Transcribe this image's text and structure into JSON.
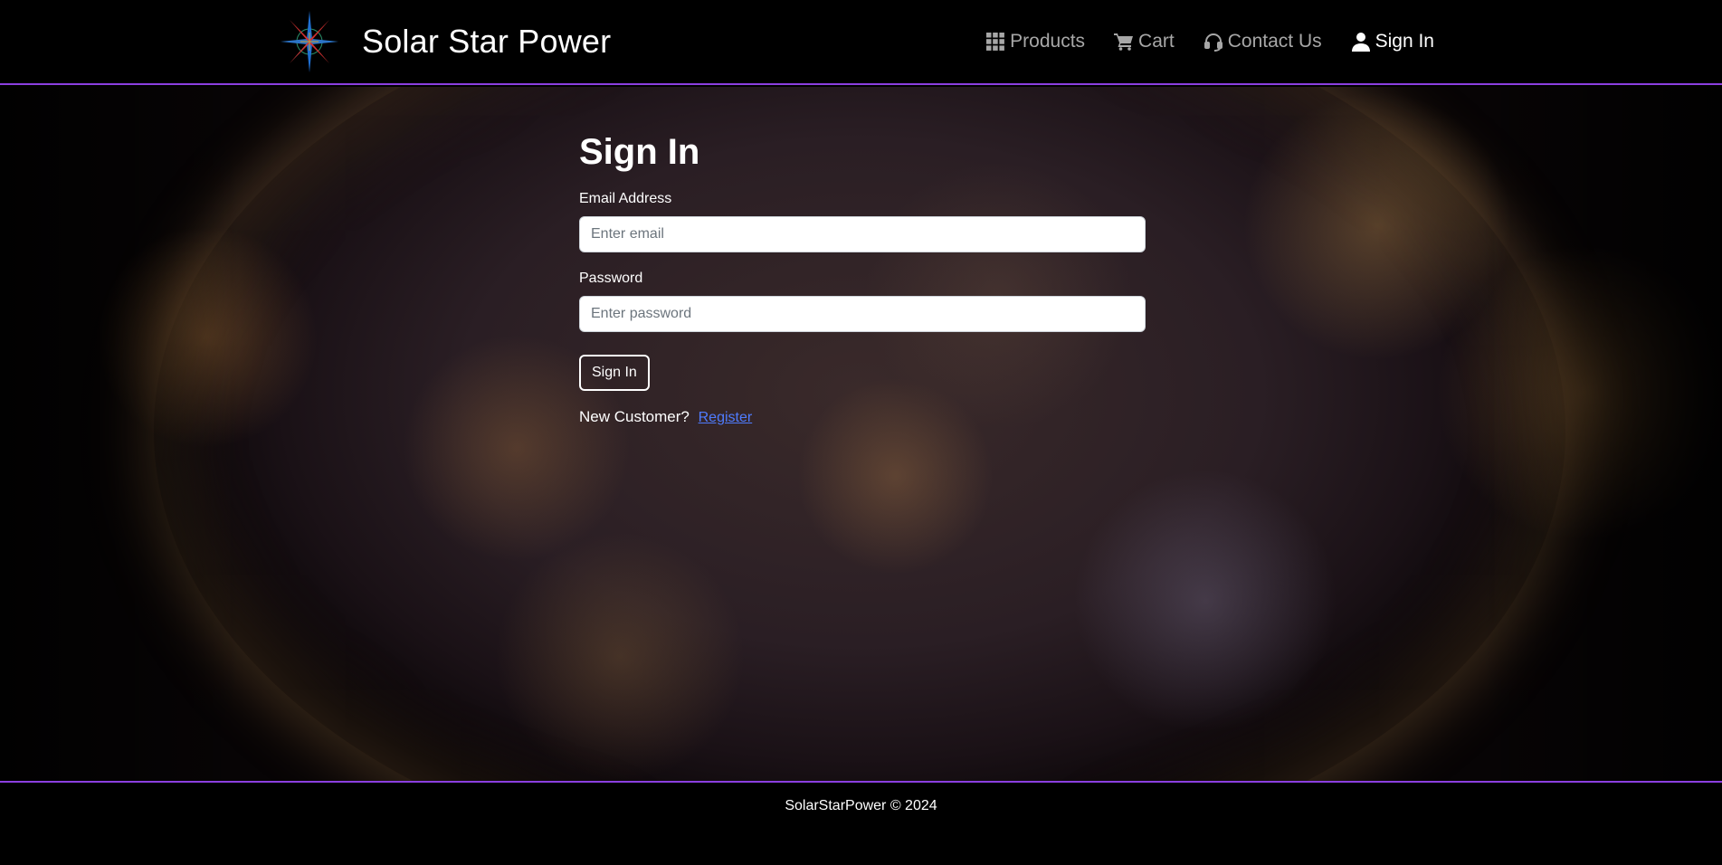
{
  "brand": {
    "name": "Solar Star Power",
    "logo_icon": "compass-star-icon"
  },
  "nav": {
    "items": [
      {
        "label": "Products",
        "icon": "grid-icon",
        "active": false
      },
      {
        "label": "Cart",
        "icon": "cart-icon",
        "active": false
      },
      {
        "label": "Contact Us",
        "icon": "headset-icon",
        "active": false
      },
      {
        "label": "Sign In",
        "icon": "user-icon",
        "active": true
      }
    ]
  },
  "signin": {
    "title": "Sign In",
    "email_label": "Email Address",
    "email_placeholder": "Enter email",
    "email_value": "",
    "password_label": "Password",
    "password_placeholder": "Enter password",
    "password_value": "",
    "submit_label": "Sign In",
    "new_customer_text": "New Customer?",
    "register_link": "Register"
  },
  "footer": {
    "text": "SolarStarPower © 2024"
  },
  "colors": {
    "accent_border": "#8b3fe0",
    "link": "#4f7cff",
    "nav_inactive": "#a7a7a7"
  }
}
